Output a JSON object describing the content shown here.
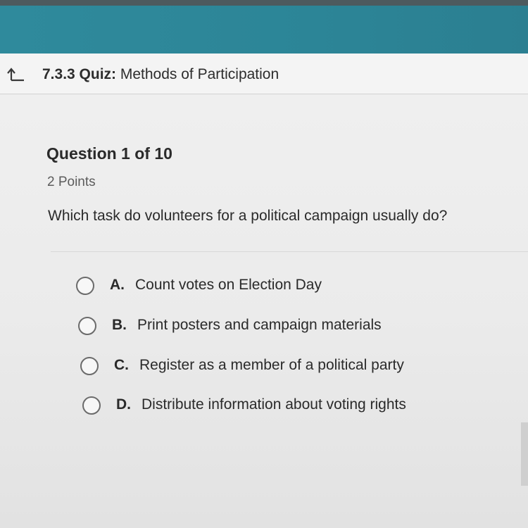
{
  "header": {
    "back_icon": "return-up-arrow-icon",
    "quiz_number": "7.3.3 Quiz:",
    "quiz_title": "Methods of Participation"
  },
  "question": {
    "counter": "Question 1 of 10",
    "points": "2 Points",
    "prompt": "Which task do volunteers for a political campaign usually do?"
  },
  "options": [
    {
      "letter": "A.",
      "text": "Count votes on Election Day"
    },
    {
      "letter": "B.",
      "text": "Print posters and campaign materials"
    },
    {
      "letter": "C.",
      "text": "Register as a member of a political party"
    },
    {
      "letter": "D.",
      "text": "Distribute information about voting rights"
    }
  ],
  "colors": {
    "header_band": "#2f8a9c",
    "top_strip": "#4d5a5e",
    "text": "#2a2a2a"
  }
}
